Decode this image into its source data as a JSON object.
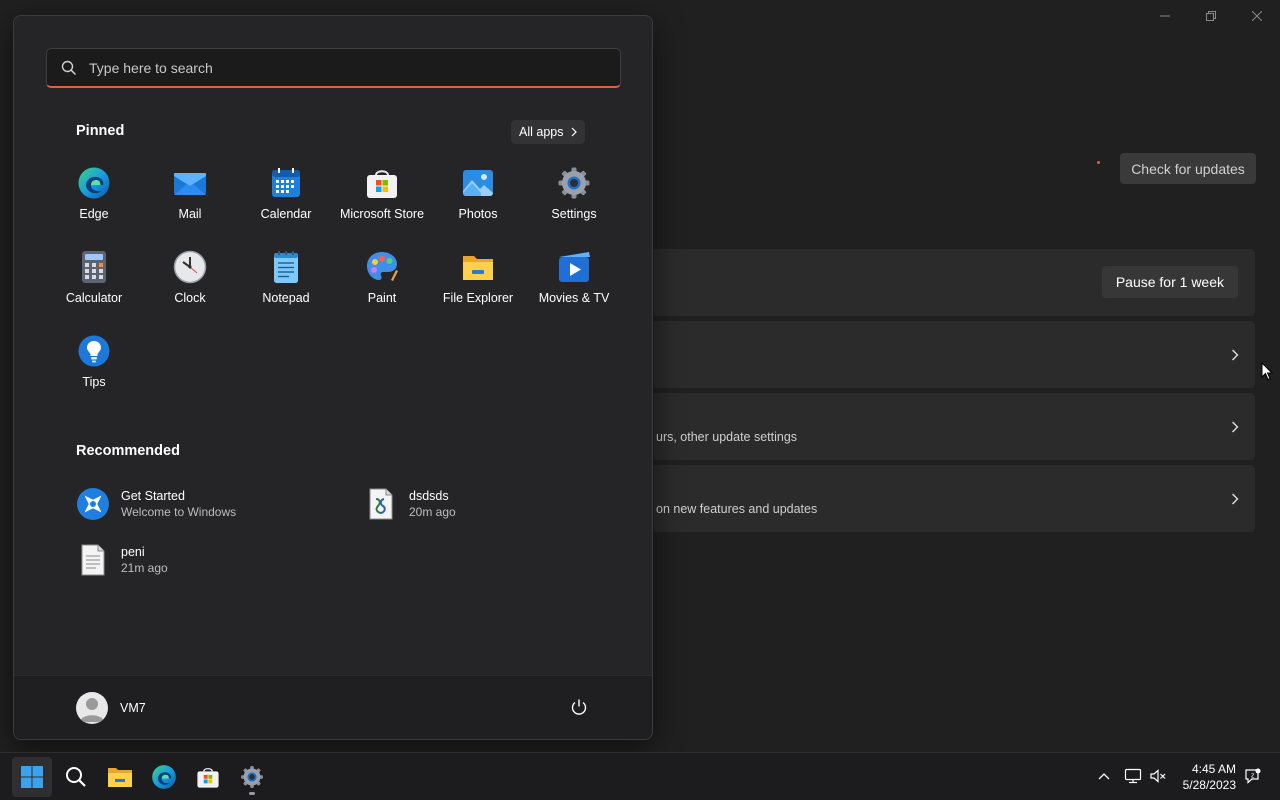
{
  "background_window": {
    "check_updates_label": "Check for updates",
    "pause_label": "Pause for 1 week",
    "card_3_subtext": "urs, other update settings",
    "card_4_subtext": "on new features and updates"
  },
  "start_menu": {
    "search": {
      "placeholder": "Type here to search",
      "value": ""
    },
    "pinned_title": "Pinned",
    "all_apps_label": "All apps",
    "pinned_apps": [
      {
        "label": "Edge",
        "icon": "edge-icon"
      },
      {
        "label": "Mail",
        "icon": "mail-icon"
      },
      {
        "label": "Calendar",
        "icon": "calendar-icon"
      },
      {
        "label": "Microsoft Store",
        "icon": "store-icon"
      },
      {
        "label": "Photos",
        "icon": "photos-icon"
      },
      {
        "label": "Settings",
        "icon": "settings-icon"
      },
      {
        "label": "Calculator",
        "icon": "calculator-icon"
      },
      {
        "label": "Clock",
        "icon": "clock-icon"
      },
      {
        "label": "Notepad",
        "icon": "notepad-icon"
      },
      {
        "label": "Paint",
        "icon": "paint-icon"
      },
      {
        "label": "File Explorer",
        "icon": "folder-icon"
      },
      {
        "label": "Movies & TV",
        "icon": "movies-icon"
      },
      {
        "label": "Tips",
        "icon": "tips-icon"
      }
    ],
    "recommended_title": "Recommended",
    "recommended": [
      {
        "name": "Get Started",
        "sub": "Welcome to Windows",
        "icon": "get-started-icon"
      },
      {
        "name": "dsdsds",
        "sub": "20m ago",
        "icon": "script-file-icon"
      },
      {
        "name": "peni",
        "sub": "21m ago",
        "icon": "text-file-icon"
      }
    ],
    "user_name": "VM7"
  },
  "taskbar": {
    "apps": [
      "start-icon",
      "search-icon",
      "file-explorer-icon",
      "edge-icon",
      "store-icon",
      "settings-icon"
    ],
    "clock_time": "4:45 AM",
    "clock_date": "5/28/2023"
  },
  "colors": {
    "accent_underline": "#e0603f",
    "start_bg": "#252527",
    "taskbar_bg": "#1c1c1e",
    "card_bg": "#2b2b2b"
  }
}
